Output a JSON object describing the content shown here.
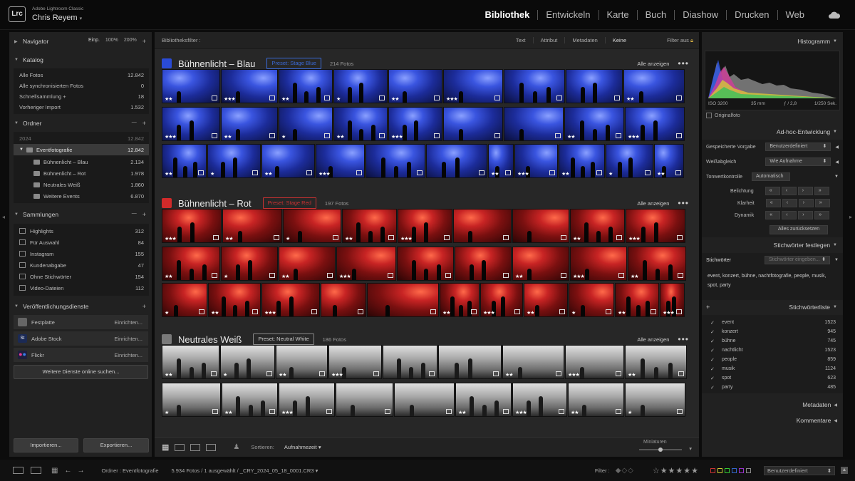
{
  "app": {
    "name": "Adobe Lightroom Classic",
    "logo": "Lrc",
    "user": "Chris Reyem"
  },
  "modules": [
    "Bibliothek",
    "Entwickeln",
    "Karte",
    "Buch",
    "Diashow",
    "Drucken",
    "Web"
  ],
  "active_module": "Bibliothek",
  "navigator": {
    "title": "Navigator",
    "fit": "Einp.",
    "z100": "100%",
    "z200": "200%"
  },
  "catalog": {
    "title": "Katalog",
    "items": [
      {
        "label": "Alle Fotos",
        "count": "12.842"
      },
      {
        "label": "Alle synchronisierten Fotos",
        "count": "0"
      },
      {
        "label": "Schnellsammlung +",
        "count": "18"
      },
      {
        "label": "Vorheriger Import",
        "count": "1.532"
      }
    ]
  },
  "folders": {
    "title": "Ordner",
    "year": {
      "label": "2024",
      "count": "12.842"
    },
    "parent": {
      "label": "Eventfotografie",
      "count": "12.842"
    },
    "items": [
      {
        "label": "Bühnenlicht – Blau",
        "count": "2.134"
      },
      {
        "label": "Bühnenlicht – Rot",
        "count": "1.978"
      },
      {
        "label": "Neutrales Weiß",
        "count": "1.860"
      },
      {
        "label": "Weitere Events",
        "count": "6.870"
      }
    ]
  },
  "collections": {
    "title": "Sammlungen",
    "items": [
      {
        "label": "Highlights",
        "count": "312"
      },
      {
        "label": "Für Auswahl",
        "count": "84"
      },
      {
        "label": "Instagram",
        "count": "155"
      },
      {
        "label": "Kundenabgabe",
        "count": "47"
      },
      {
        "label": "Ohne Stichwörter",
        "count": "154"
      },
      {
        "label": "Video-Dateien",
        "count": "112"
      }
    ]
  },
  "publish": {
    "title": "Veröffentlichungsdienste",
    "items": [
      {
        "label": "Festplatte",
        "action": "Einrichten..."
      },
      {
        "label": "Adobe Stock",
        "icon": "St",
        "action": "Einrichten..."
      },
      {
        "label": "Flickr",
        "action": "Einrichten..."
      }
    ],
    "more": "Weitere Dienste online suchen..."
  },
  "buttons": {
    "import": "Importieren...",
    "export": "Exportieren..."
  },
  "filter": {
    "label": "Bibliotheksfilter :",
    "tabs": [
      "Text",
      "Attribut",
      "Metadaten",
      "Keine"
    ],
    "off": "Filter aus"
  },
  "groups": [
    {
      "title": "Bühnenlicht – Blau",
      "preset": "Preset: Stage Blue",
      "count": "214 Fotos",
      "show_all": "Alle anzeigen",
      "color": "#2a4bd6",
      "preset_color": "#3a6ad8"
    },
    {
      "title": "Bühnenlicht – Rot",
      "preset": "Preset: Stage Red",
      "count": "197 Fotos",
      "show_all": "Alle anzeigen",
      "color": "#d12a2a",
      "preset_color": "#c83232"
    },
    {
      "title": "Neutrales Weiß",
      "preset": "Preset: Neutral White",
      "count": "186 Fotos",
      "show_all": "Alle anzeigen",
      "color": "#7a7a7a",
      "preset_color": "#aaaaaa"
    }
  ],
  "toolbar": {
    "sort_label": "Sortieren:",
    "sort_value": "Aufnahmezeit",
    "thumbs_label": "Miniaturen",
    "thumb_level": 0.5
  },
  "histogram": {
    "title": "Histogramm",
    "iso": "ISO 3200",
    "focal": "35 mm",
    "aperture": "ƒ / 2,8",
    "shutter": "1/250 Sek.",
    "original": "Originalfoto"
  },
  "quick_develop": {
    "title": "Ad-hoc-Entwicklung",
    "preset_label": "Gespeicherte Vorgabe",
    "preset_value": "Benutzerdefiniert",
    "wb_label": "Weißabgleich",
    "wb_value": "Wie Aufnahme",
    "tone_label": "Tonwertkontrolle",
    "tone_value": "Automatisch",
    "exposure": "Belichtung",
    "clarity": "Klarheit",
    "vibrance": "Dynamik",
    "reset": "Alles zurücksetzen"
  },
  "keywording": {
    "title": "Stichwörter festlegen",
    "label": "Stichwörter",
    "placeholder": "Stichwörter eingeben...",
    "text": "event, konzert, bühne, nachtfotografie, people, musik, spot, party"
  },
  "keyword_list": {
    "title": "Stichwörterliste",
    "items": [
      {
        "label": "event",
        "count": "1523"
      },
      {
        "label": "konzert",
        "count": "945"
      },
      {
        "label": "bühne",
        "count": "745"
      },
      {
        "label": "nachtlicht",
        "count": "1523"
      },
      {
        "label": "people",
        "count": "859"
      },
      {
        "label": "musik",
        "count": "1124"
      },
      {
        "label": "spot",
        "count": "623"
      },
      {
        "label": "party",
        "count": "485"
      }
    ]
  },
  "metadata_title": "Metadaten",
  "comments_title": "Kommentare",
  "status": {
    "folder": "Ordner : Eventfotografie",
    "info": "5.934 Fotos / 1 ausgewählt / _CRY_2024_05_18_0001.CR3",
    "filter_label": "Filter :",
    "filter_value": "Benutzerdefiniert"
  }
}
